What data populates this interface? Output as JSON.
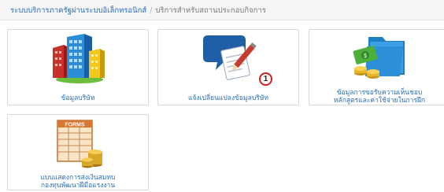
{
  "breadcrumb": {
    "root": "ระบบบริการภาครัฐผ่านระบบอิเล็กทรอนิกส์",
    "separator": "/",
    "current": "บริการสำหรับสถานประกอบกิจการ"
  },
  "cards": [
    {
      "label": "ข้อมูลบริษัท",
      "icon": "office-buildings-icon"
    },
    {
      "label": "แจ้งเปลี่ยนแปลงข้อมูลบริษัท",
      "icon": "chat-document-pen-icon",
      "badge": "1"
    },
    {
      "label_line1": "ข้อมูลการขอรับความเห็นชอบ",
      "label_line2": "หลักสูตรและค่าใช้จ่ายในการฝึก",
      "icon": "folder-money-icon"
    },
    {
      "label_line1": "แบบแสดงการส่งเงินสมทบ",
      "label_line2": "กองทุนพัฒนาฝีมือแรงงาน",
      "icon": "forms-coins-icon",
      "icon_text": "FORMS"
    }
  ],
  "colors": {
    "link": "#2a6fb5",
    "badge_ring": "#d21e1e",
    "card_border": "#d8d8d8",
    "breadcrumb_bg": "#f5f5f5"
  }
}
